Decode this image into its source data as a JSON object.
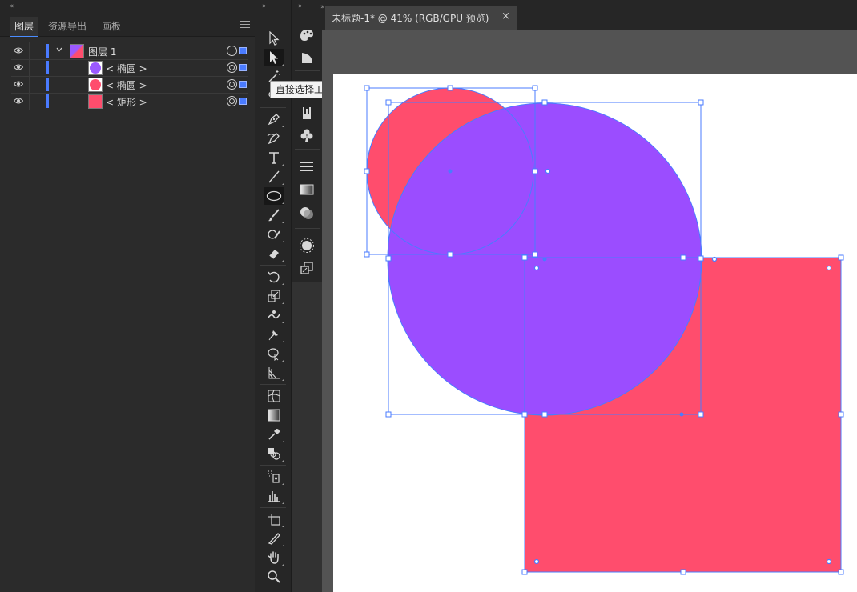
{
  "layers_panel": {
    "collapse_glyph": "‹‹",
    "tabs": [
      {
        "label": "图层",
        "active": true
      },
      {
        "label": "资源导出",
        "active": false
      },
      {
        "label": "画板",
        "active": false
      }
    ],
    "menu_icon": "hamburger-menu-icon",
    "layers": [
      {
        "name": "图层  1",
        "kind": "layer",
        "expanded": true,
        "thumb": "layer-thumbnail"
      },
      {
        "name": "< 椭圆 >",
        "kind": "path",
        "thumb_color": "#9b59ff"
      },
      {
        "name": "< 椭圆 >",
        "kind": "path",
        "thumb_color": "#ff4d6d"
      },
      {
        "name": "< 矩形 >",
        "kind": "path",
        "thumb_color": "#ff4d6d"
      }
    ],
    "selection_color": "#4a7bff"
  },
  "toolbar": {
    "collapse_glyph": "››",
    "tooltip": "直接选择工具 (A)",
    "tools": [
      "selection-tool",
      "direct-selection-tool",
      "magic-wand-tool",
      "lasso-tool",
      "pen-tool",
      "curvature-tool",
      "type-tool",
      "line-segment-tool",
      "ellipse-tool",
      "paintbrush-tool",
      "shaper-tool",
      "eraser-tool",
      "rotate-tool",
      "scale-tool",
      "warp-tool",
      "puppet-warp-tool",
      "shape-builder-tool",
      "perspective-grid-tool",
      "mesh-tool",
      "gradient-tool",
      "eyedropper-tool",
      "blend-tool",
      "symbol-sprayer-tool",
      "column-graph-tool",
      "artboard-tool",
      "slice-tool",
      "hand-tool",
      "zoom-tool"
    ]
  },
  "side_panels": {
    "icons": [
      "color-panel-icon",
      "color-guide-icon",
      "brushes-icon",
      "symbols-icon",
      "stroke-icon",
      "gradient-icon",
      "transparency-icon",
      "appearance-icon",
      "graphic-styles-icon"
    ]
  },
  "document": {
    "tab_title": "未标题-1* @ 41% (RGB/GPU 预览)",
    "close_glyph": "×",
    "colors": {
      "pink": "#ff4d6d",
      "purple": "#9b4dff",
      "selection": "#4a7bff",
      "canvas_bg": "#535353",
      "artboard": "#ffffff"
    },
    "objects": [
      "pink-circle",
      "purple-circle",
      "pink-rectangle"
    ]
  }
}
